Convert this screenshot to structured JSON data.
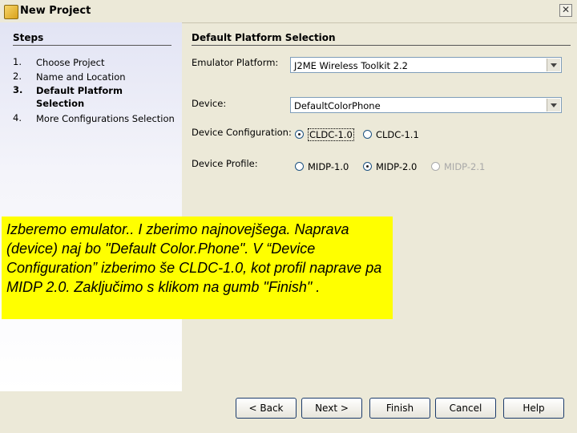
{
  "window": {
    "title": "New Project",
    "close_glyph": "✕"
  },
  "steps": {
    "title": "Steps",
    "items": [
      {
        "num": "1.",
        "label": "Choose Project"
      },
      {
        "num": "2.",
        "label": "Name and Location"
      },
      {
        "num": "3.",
        "label": "Default Platform Selection"
      },
      {
        "num": "4.",
        "label": "More Configurations Selection"
      }
    ]
  },
  "main": {
    "title": "Default Platform Selection",
    "emulator": {
      "label": "Emulator Platform:",
      "value": "J2ME Wireless Toolkit 2.2"
    },
    "device": {
      "label": "Device:",
      "value": "DefaultColorPhone"
    },
    "configuration": {
      "label": "Device Configuration:",
      "options": [
        "CLDC-1.0",
        "CLDC-1.1"
      ],
      "selected": "CLDC-1.0"
    },
    "profile": {
      "label": "Device Profile:",
      "options": [
        "MIDP-1.0",
        "MIDP-2.0",
        "MIDP-2.1"
      ],
      "selected": "MIDP-2.0",
      "disabled": "MIDP-2.1"
    }
  },
  "note": "Izberemo emulator.. I zberimo najnovejšega. Naprava (device) naj bo \"Default Color.Phone\". V “Device Configuration” izberimo še CLDC-1.0, kot profil naprave pa MIDP 2.0. Zaključimo s klikom na gumb \"Finish\" .",
  "buttons": {
    "back": "< Back",
    "next": "Next >",
    "finish": "Finish",
    "cancel": "Cancel",
    "help": "Help"
  }
}
